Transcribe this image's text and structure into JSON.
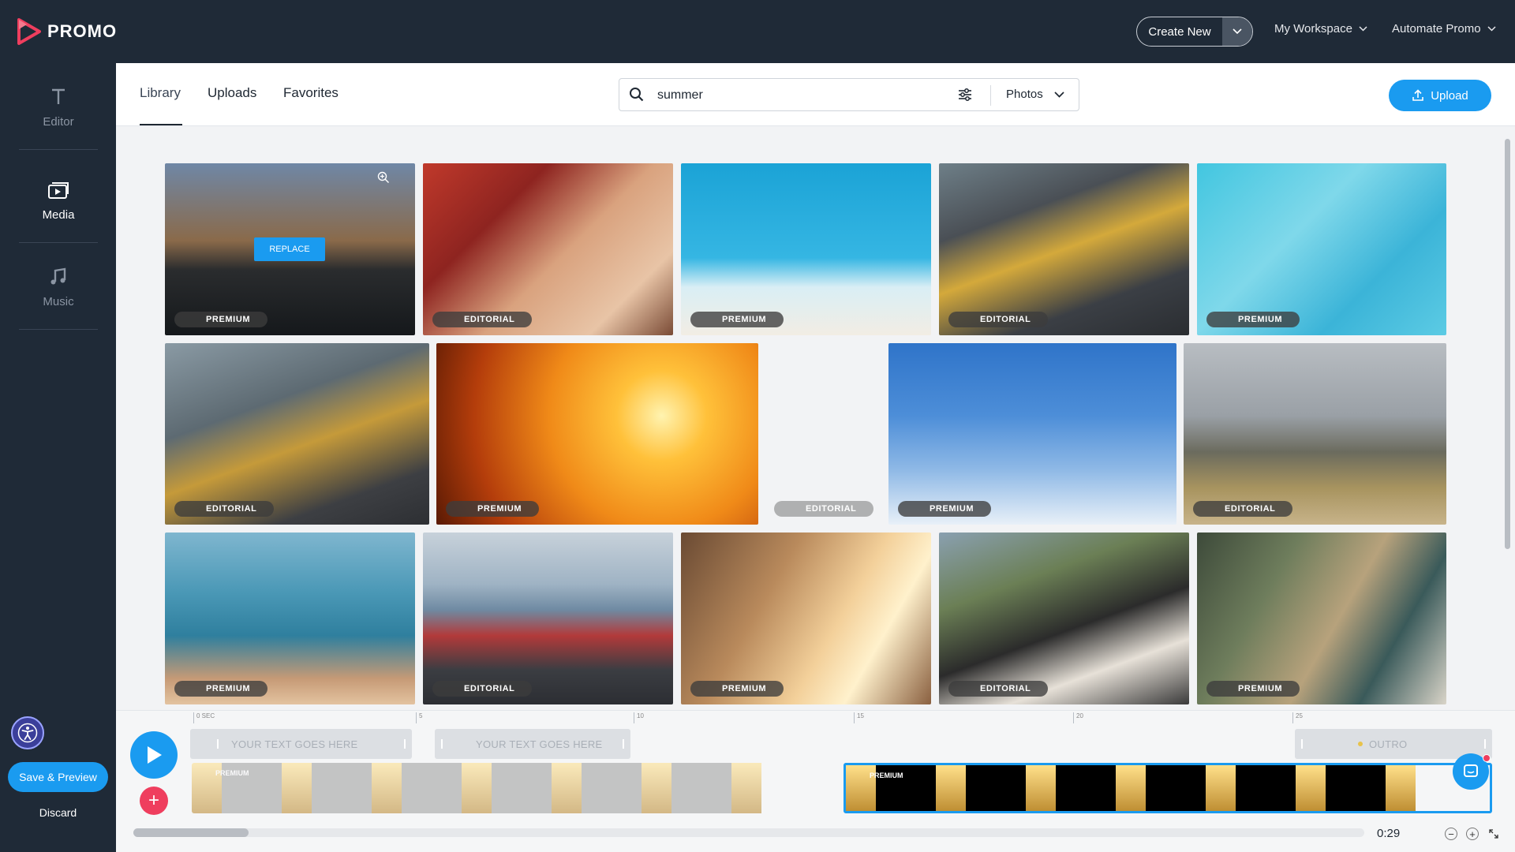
{
  "app": {
    "logo_text": "PROMO"
  },
  "topbar": {
    "create_new": "Create New",
    "workspace": "My Workspace",
    "automate": "Automate Promo"
  },
  "sidebar": {
    "items": [
      {
        "label": "Editor",
        "icon": "text-icon"
      },
      {
        "label": "Media",
        "icon": "media-icon"
      },
      {
        "label": "Music",
        "icon": "music-icon"
      }
    ],
    "save_preview": "Save & Preview",
    "discard": "Discard"
  },
  "library": {
    "tabs": [
      "Library",
      "Uploads",
      "Favorites"
    ],
    "active_tab": "Library",
    "search_value": "summer",
    "media_type": "Photos",
    "upload_label": "Upload",
    "replace_label": "REPLACE"
  },
  "tiles": [
    {
      "badge": "PREMIUM"
    },
    {
      "badge": "EDITORIAL"
    },
    {
      "badge": "PREMIUM"
    },
    {
      "badge": "EDITORIAL"
    },
    {
      "badge": "PREMIUM"
    },
    {
      "badge": "EDITORIAL"
    },
    {
      "badge": "PREMIUM"
    },
    {
      "badge": "EDITORIAL"
    },
    {
      "badge": "PREMIUM"
    },
    {
      "badge": "EDITORIAL"
    },
    {
      "badge": "PREMIUM"
    },
    {
      "badge": "EDITORIAL"
    },
    {
      "badge": "PREMIUM"
    },
    {
      "badge": "EDITORIAL"
    },
    {
      "badge": "PREMIUM"
    }
  ],
  "timeline": {
    "ruler": [
      "0 SEC",
      "5",
      "10",
      "15",
      "20",
      "25"
    ],
    "text_clip_1": "YOUR TEXT GOES HERE",
    "text_clip_2": "YOUR TEXT GOES HERE",
    "outro": "OUTRO",
    "clip_label_1": "PREMIUM",
    "clip_label_2": "PREMIUM",
    "time": "0:29"
  },
  "colors": {
    "accent": "#1a9bf0",
    "sidebar_bg": "#1f2a37",
    "brand_red": "#ef3e5e"
  }
}
